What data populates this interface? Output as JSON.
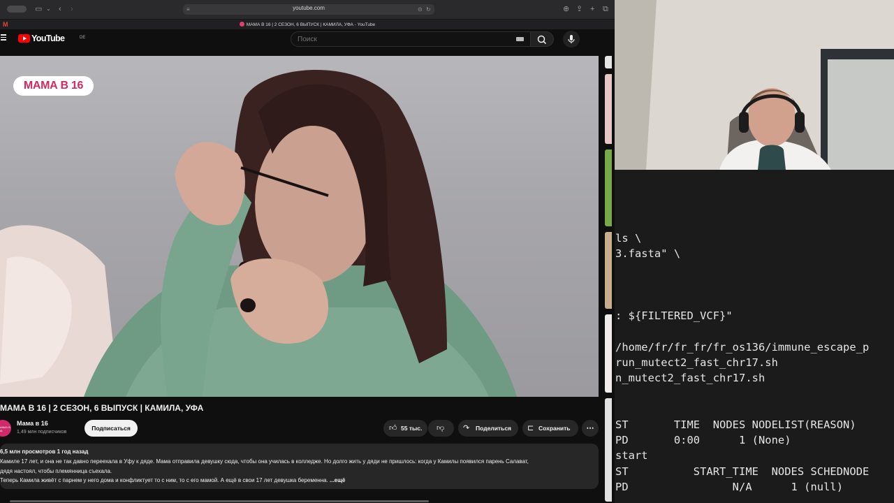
{
  "browser": {
    "address": "youtube.com",
    "tab_title": "МАМА В 16 | 2 СЕЗОН, 6 ВЫПУСК | КАМИЛА, УФА - YouTube",
    "gmail_tab": "M"
  },
  "youtube": {
    "logo_text": "YouTube",
    "region": "DE",
    "search_placeholder": "Поиск",
    "show_logo": "МАМА В 16",
    "video_title": "МАМА В 16 | 2 СЕЗОН, 6 ВЫПУСК | КАМИЛА, УФА",
    "channel_name": "Мама в 16",
    "channel_subscribers": "1,49 млн подписчиков",
    "subscribe_label": "Подписаться",
    "likes": "55 тыс.",
    "share_label": "Поделиться",
    "save_label": "Сохранить",
    "description": {
      "stats": "6,5 млн просмотров  1 год назад",
      "line1": "Камиле 17 лет, и она не так давно переехала в Уфу к дяде. Мама отправила девушку сюда, чтобы она училась в колледже. Но долго жить у дяди не пришлось: когда у Камилы появился парень Салават,",
      "line2": "дядя настоял, чтобы племянница съехала.",
      "line3": "Теперь Камила живёт с парнем у него дома и конфликтует то с ним, то с его мамой. А ещё в свои 17 лет девушка беременна.",
      "more": "...ещё"
    }
  },
  "terminal": {
    "lines": [
      "ls \\",
      "3.fasta\" \\",
      ": ${FILTERED_VCF}\"",
      "/home/fr/fr_fr/fr_os136/immune_escape_p",
      "run_mutect2_fast_chr17.sh",
      "n_mutect2_fast_chr17.sh",
      "ST       TIME  NODES NODELIST(REASON)",
      "PD       0:00      1 (None)",
      "start",
      "ST          START_TIME  NODES SCHEDNODE",
      "PD                N/A      1 (null)"
    ]
  },
  "colors": {
    "youtube_red": "#ff0000",
    "show_pink": "#d6285f",
    "yt_background": "#0f0f0f",
    "terminal_background": "#1b1b1b"
  }
}
